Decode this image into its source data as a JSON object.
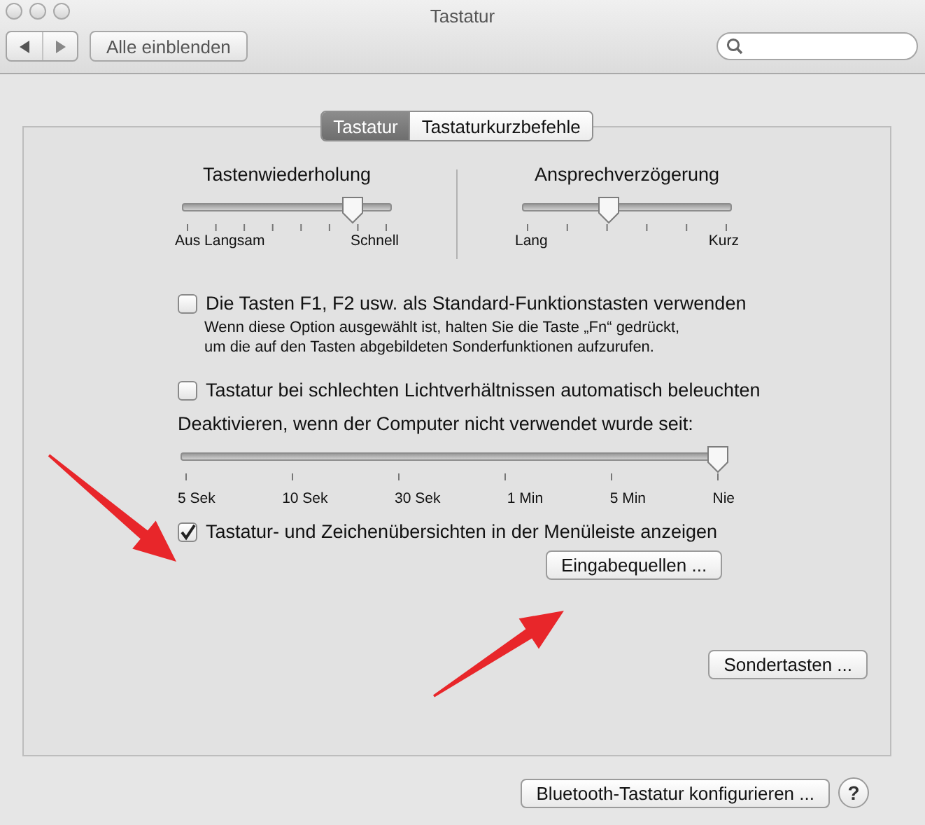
{
  "window": {
    "title": "Tastatur"
  },
  "toolbar": {
    "show_all_button": "Alle einblenden"
  },
  "tabs": [
    {
      "label": "Tastatur",
      "selected": true
    },
    {
      "label": "Tastaturkurzbefehle",
      "selected": false
    }
  ],
  "sliders": [
    {
      "title": "Tastenwiederholung",
      "level": 0.83,
      "labels": [
        "Aus Langsam",
        "Schnell"
      ]
    },
    {
      "title": "Ansprechverzögerung",
      "level": 0.41,
      "labels": [
        "Lang",
        "Kurz"
      ]
    }
  ],
  "function_keys": {
    "label": "Die Tasten F1, F2 usw. als Standard-Funktionstasten verwenden",
    "checked": false,
    "description": "Wenn diese Option ausgewählt ist, halten Sie die Taste „Fn“ gedrückt,\num die auf den Tasten abgebildeten Sonderfunktionen aufzurufen."
  },
  "backlight": {
    "label": "Tastatur bei schlechten Lichtverhältnissen automatisch beleuchten",
    "checked": false,
    "slider_label": "Deaktivieren, wenn der Computer nicht verwendet wurde seit:",
    "level": 1,
    "labels": [
      "5 Sek",
      "10 Sek",
      "30 Sek",
      "1 Min",
      "5 Min",
      "Nie"
    ]
  },
  "menu_bar_viewer": {
    "label": "Tastatur- und Zeichenübersichten in der Menüleiste anzeigen",
    "checked": true,
    "button": "Eingabequellen ..."
  },
  "modifier_button": "Sondertasten ...",
  "bluetooth_button": "Bluetooth-Tastatur konfigurieren ...",
  "help_button": "?"
}
